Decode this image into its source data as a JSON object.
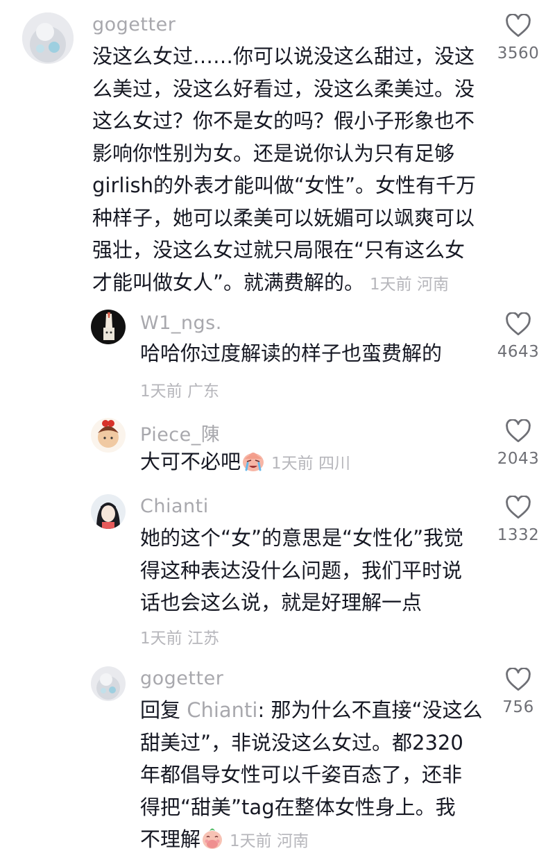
{
  "comments": [
    {
      "username": "gogetter",
      "lines": [
        "没这么女过……你可以说没这么甜过，没这",
        "么美过，没这么好看过，没这么柔美过。没",
        "这么女过？你不是女的吗？假小子形象也不",
        "影响你性别为女。还是说你认为只有足够",
        "girlish的外表才能叫做“女性”。女性有千万",
        "种样子，她可以柔美可以妩媚可以飒爽可以",
        "强壮，没这么女过就只局限在“只有这么女",
        "才能叫做女人”。就满费解的。"
      ],
      "meta": "1天前 河南",
      "likes": "3560"
    },
    {
      "username": "W1_ngs.",
      "lines": [
        "哈哈你过度解读的样子也蛮费解的"
      ],
      "meta": "1天前 广东",
      "likes": "4643"
    },
    {
      "username": "Piece_陳",
      "lines": [
        "大可不必吧"
      ],
      "meta": "1天前 四川",
      "likes": "2043",
      "emoji": "crying-face-emoji"
    },
    {
      "username": "Chianti",
      "lines": [
        "她的这个“女”的意思是“女性化”我觉",
        "得这种表达没什么问题，我们平时说",
        "话也会这么说，就是好理解一点"
      ],
      "meta": "1天前 江苏",
      "likes": "1332"
    },
    {
      "username": "gogetter",
      "reply_prefix": "回复 ",
      "reply_to": "Chianti",
      "lines": [
        ": 那为什么不直接“没这么",
        "甜美过”，非说没这么女过。都2320",
        "年都倡导女性可以千姿百态了，还非",
        "得把“甜美”tag在整体女性身上。我",
        "不理解"
      ],
      "meta": "1天前 河南",
      "likes": "756",
      "emoji": "hand-over-mouth-emoji"
    }
  ],
  "icons": {
    "like": "heart-outline-icon"
  },
  "colors": {
    "text": "#161823",
    "username": "#a8a8ad",
    "meta": "#b6b6bb",
    "count": "#6e6f75"
  }
}
